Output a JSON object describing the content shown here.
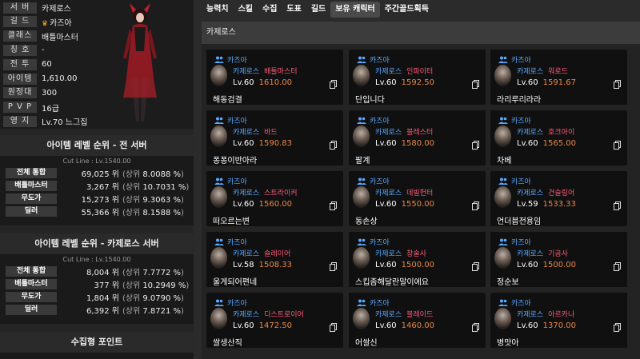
{
  "profile": {
    "rows": [
      {
        "label": "서 버",
        "value": "카제로스",
        "crown": false
      },
      {
        "label": "길 드",
        "value": "카즈아",
        "crown": true
      },
      {
        "label": "클래스",
        "value": "배틀마스터",
        "crown": false
      },
      {
        "label": "칭 호",
        "value": "-",
        "crown": false
      },
      {
        "label": "전 투",
        "value": "60",
        "crown": false
      },
      {
        "label": "아이템",
        "value": "1,610.00",
        "crown": false
      },
      {
        "label": "원정대",
        "value": "300",
        "crown": false
      },
      {
        "label": "P V P",
        "value": "16급",
        "crown": false
      },
      {
        "label": "영 지",
        "value": "Lv.70 느그집",
        "crown": false
      }
    ]
  },
  "ranking_all": {
    "title": "아이템 레벨 순위 - 전 서버",
    "cutline": "Cut Line : Lv.1540.00",
    "rows": [
      {
        "label": "전체 통합",
        "rank": "69,025 위",
        "pct": "8.0088 %"
      },
      {
        "label": "배틀마스터",
        "rank": "3,267 위",
        "pct": "10.7031 %"
      },
      {
        "label": "무도가",
        "rank": "15,273 위",
        "pct": "9.3063 %"
      },
      {
        "label": "딜러",
        "rank": "55,366 위",
        "pct": "8.1588 %"
      }
    ]
  },
  "ranking_server": {
    "title": "아이템 레벨 순위 - 카제로스 서버",
    "cutline": "Cut Line : Lv.1540.00",
    "rows": [
      {
        "label": "전체 통합",
        "rank": "8,004 위",
        "pct": "7.7772 %"
      },
      {
        "label": "배틀마스터",
        "rank": "377 위",
        "pct": "10.2949 %"
      },
      {
        "label": "무도가",
        "rank": "1,804 위",
        "pct": "9.0790 %"
      },
      {
        "label": "딜러",
        "rank": "6,392 위",
        "pct": "7.8721 %"
      }
    ]
  },
  "rank_prefix": "(상위",
  "rank_suffix": ")",
  "collect_title": "수집형 포인트",
  "tabs": [
    "능력치",
    "스킬",
    "수집",
    "도표",
    "길드",
    "보유 캐릭터",
    "주간골드획득"
  ],
  "active_tab": 5,
  "server_header": "카제로스",
  "characters": [
    {
      "guild": "카즈아",
      "server": "카제로스",
      "class": "배틀마스터",
      "level": "Lv.60",
      "ilvl": "1610.00",
      "name": "해동검결"
    },
    {
      "guild": "카즈아",
      "server": "카제로스",
      "class": "인파이터",
      "level": "Lv.60",
      "ilvl": "1592.50",
      "name": "단입니다"
    },
    {
      "guild": "카즈아",
      "server": "카제로스",
      "class": "워로드",
      "level": "Lv.60",
      "ilvl": "1591.67",
      "name": "라리루리라라"
    },
    {
      "guild": "카즈아",
      "server": "카제로스",
      "class": "바드",
      "level": "Lv.60",
      "ilvl": "1590.83",
      "name": "퐁퐁이반아라"
    },
    {
      "guild": "카즈아",
      "server": "카제로스",
      "class": "블레스터",
      "level": "Lv.60",
      "ilvl": "1580.00",
      "name": "팔계"
    },
    {
      "guild": "카즈아",
      "server": "카제로스",
      "class": "호크아이",
      "level": "Lv.60",
      "ilvl": "1565.00",
      "name": "차베"
    },
    {
      "guild": "카즈아",
      "server": "카제로스",
      "class": "스트라이커",
      "level": "Lv.60",
      "ilvl": "1560.00",
      "name": "떠오르는변"
    },
    {
      "guild": "카즈아",
      "server": "카제로스",
      "class": "데빌헌터",
      "level": "Lv.60",
      "ilvl": "1550.00",
      "name": "동손상"
    },
    {
      "guild": "카즈아",
      "server": "카제로스",
      "class": "건슬링어",
      "level": "Lv.59",
      "ilvl": "1533.33",
      "name": "언더붑전용임"
    },
    {
      "guild": "카즈아",
      "server": "카제로스",
      "class": "슬레이어",
      "level": "Lv.58",
      "ilvl": "1508.33",
      "name": "울게되어편네"
    },
    {
      "guild": "카즈아",
      "server": "카제로스",
      "class": "창술사",
      "level": "Lv.60",
      "ilvl": "1500.00",
      "name": "스킵좀해달란말이에요"
    },
    {
      "guild": "카즈아",
      "server": "카제로스",
      "class": "기공사",
      "level": "Lv.60",
      "ilvl": "1500.00",
      "name": "정순보"
    },
    {
      "guild": "카즈아",
      "server": "카제로스",
      "class": "디스트로이어",
      "level": "Lv.60",
      "ilvl": "1472.50",
      "name": "쌀생산직"
    },
    {
      "guild": "카즈아",
      "server": "카제로스",
      "class": "블레이드",
      "level": "Lv.60",
      "ilvl": "1460.00",
      "name": "어쌀신"
    },
    {
      "guild": "카즈아",
      "server": "카제로스",
      "class": "아르카나",
      "level": "Lv.60",
      "ilvl": "1370.00",
      "name": "병맛아"
    }
  ]
}
